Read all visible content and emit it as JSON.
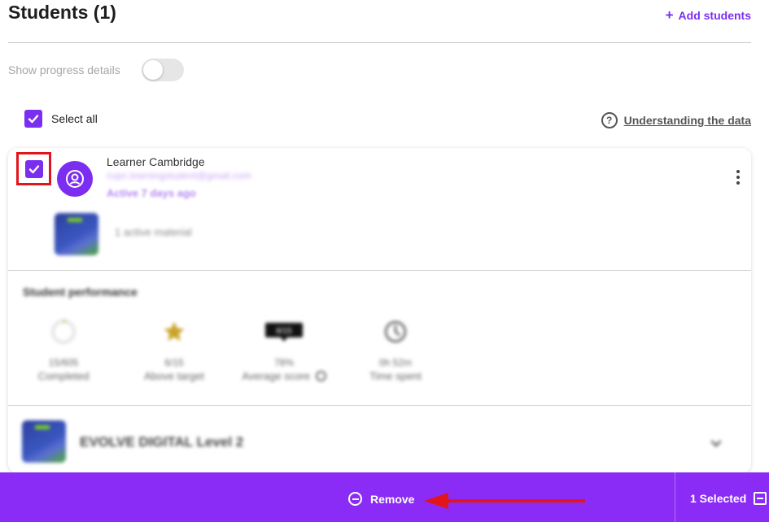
{
  "header": {
    "title": "Students (1)",
    "add_students_label": "Add students"
  },
  "controls": {
    "show_progress_label": "Show progress details",
    "show_progress_on": false,
    "select_all_label": "Select all",
    "select_all_checked": true,
    "understanding_label": "Understanding the data"
  },
  "student": {
    "checked": true,
    "name": "Learner Cambridge",
    "email": "cupc.learningstudent@gmail.com",
    "activity": "Active 7 days ago",
    "materials_text": "1 active material"
  },
  "performance": {
    "title": "Student performance",
    "metrics": [
      {
        "value": "15/605",
        "label": "Completed",
        "icon": "progress-ring-icon"
      },
      {
        "value": "6/15",
        "label": "Above target",
        "icon": "star-icon"
      },
      {
        "value": "78%",
        "label": "Average score",
        "icon": "score-badge-icon",
        "badge_text": "8/15"
      },
      {
        "value": "0h 52m",
        "label": "Time spent",
        "icon": "clock-icon"
      }
    ]
  },
  "course": {
    "name": "EVOLVE DIGITAL Level 2"
  },
  "action_bar": {
    "remove_label": "Remove",
    "selected_label": "1 Selected"
  },
  "colors": {
    "accent": "#7c2ef0",
    "action_bar": "#8a2cf5",
    "highlight_box": "#e2141c",
    "arrow": "#e2141c"
  }
}
